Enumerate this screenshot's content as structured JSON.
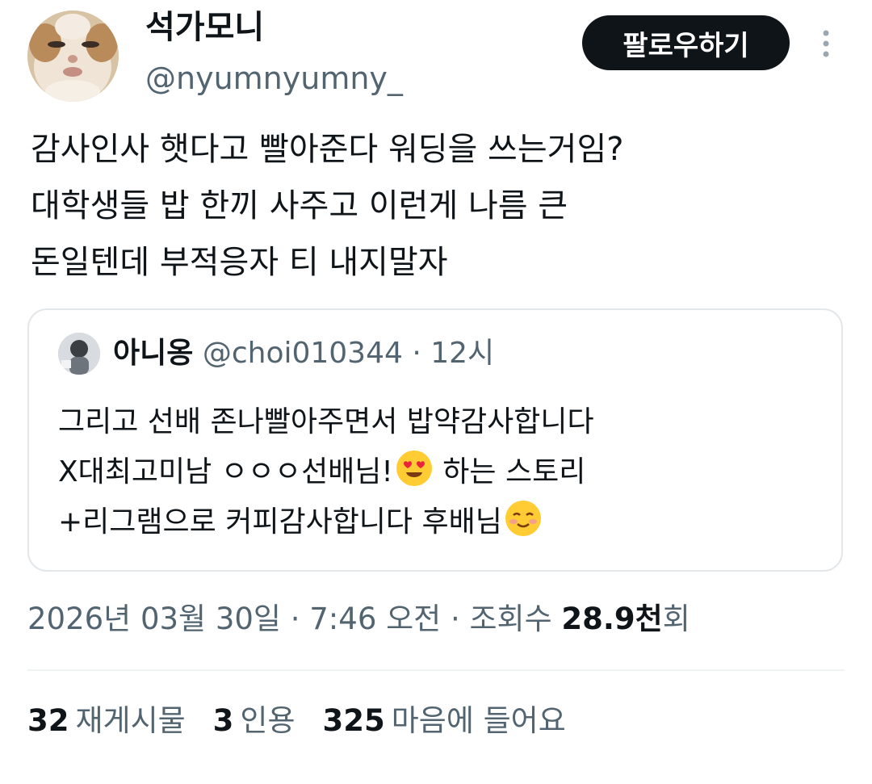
{
  "author": {
    "display_name": "석가모니",
    "handle": "@nyumnyumny_",
    "follow_label": "팔로우하기",
    "avatar_icon": "avatar-image"
  },
  "tweet": {
    "lines": [
      "감사인사 햇다고 빨아준다 워딩을 쓰는거임?",
      "대학생들 밥 한끼 사주고 이런게 나름 큰",
      "돈일텐데 부적응자 티 내지말자"
    ]
  },
  "quote": {
    "display_name": "아니옹",
    "handle": "@choi010344",
    "separator": "·",
    "time": "12시",
    "line1": "그리고 선배 존나빨아주면서 밥약감사합니다",
    "line2_text": "X대최고미남 ㅇㅇㅇ선배님!",
    "line2_emoji": "heart-eyes-emoji",
    "line2_tail": " 하는 스토리",
    "line3_text": "+리그램으로 커피감사합니다 후배님",
    "line3_emoji": "smiling-blush-emoji"
  },
  "meta": {
    "date": "2026년 03월 30일",
    "sep": " · ",
    "time": "7:46 오전",
    "views_label": "조회수 ",
    "views_value": "28.9천",
    "views_suffix": "회"
  },
  "stats": {
    "retweets_count": "32",
    "retweets_label": "재게시물",
    "quotes_count": "3",
    "quotes_label": "인용",
    "likes_count": "325",
    "likes_label": "마음에 들어요"
  },
  "colors": {
    "text": "#0f1419",
    "muted": "#536471",
    "border": "#e3e7ea",
    "button_bg": "#0f1419"
  }
}
